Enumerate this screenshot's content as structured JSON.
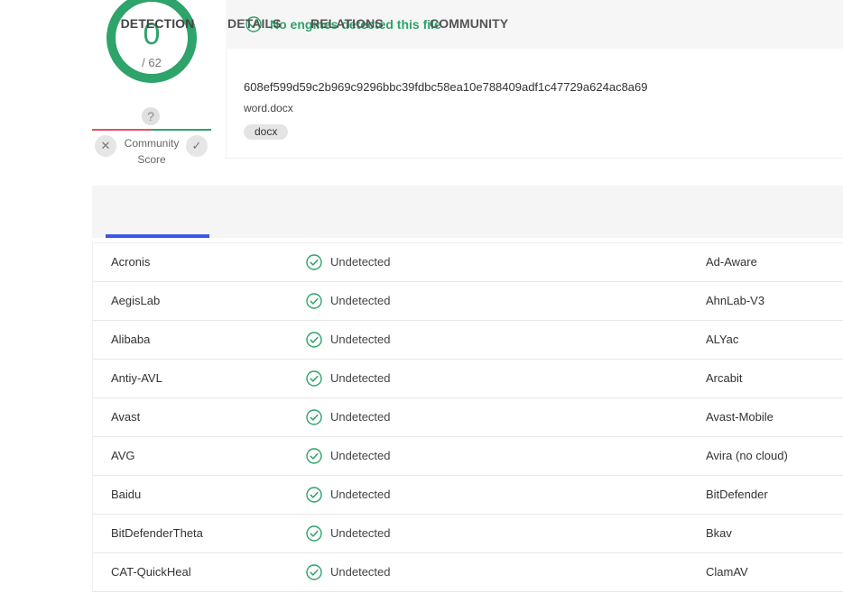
{
  "score": {
    "detections": "0",
    "total": "/ 62",
    "unknown_mark": "?",
    "community_label_line1": "Community",
    "community_label_line2": "Score",
    "vote_down": "✕",
    "vote_up": "✓"
  },
  "status": {
    "message": "No engines detected this file",
    "color": "#2ea36a"
  },
  "file": {
    "hash": "608ef599d59c2b969c9296bbc39fdbc58ea10e788409adf1c47729a624ac8a69",
    "name": "word.docx",
    "tag": "docx"
  },
  "tabs": {
    "detection": "DETECTION",
    "details": "DETAILS",
    "relations": "RELATIONS",
    "community": "COMMUNITY",
    "active": "DETECTION",
    "active_color": "#3b57e8"
  },
  "results": [
    {
      "left": "Acronis",
      "status": "Undetected",
      "right": "Ad-Aware"
    },
    {
      "left": "AegisLab",
      "status": "Undetected",
      "right": "AhnLab-V3"
    },
    {
      "left": "Alibaba",
      "status": "Undetected",
      "right": "ALYac"
    },
    {
      "left": "Antiy-AVL",
      "status": "Undetected",
      "right": "Arcabit"
    },
    {
      "left": "Avast",
      "status": "Undetected",
      "right": "Avast-Mobile"
    },
    {
      "left": "AVG",
      "status": "Undetected",
      "right": "Avira (no cloud)"
    },
    {
      "left": "Baidu",
      "status": "Undetected",
      "right": "BitDefender"
    },
    {
      "left": "BitDefenderTheta",
      "status": "Undetected",
      "right": "Bkav"
    },
    {
      "left": "CAT-QuickHeal",
      "status": "Undetected",
      "right": "ClamAV"
    }
  ]
}
